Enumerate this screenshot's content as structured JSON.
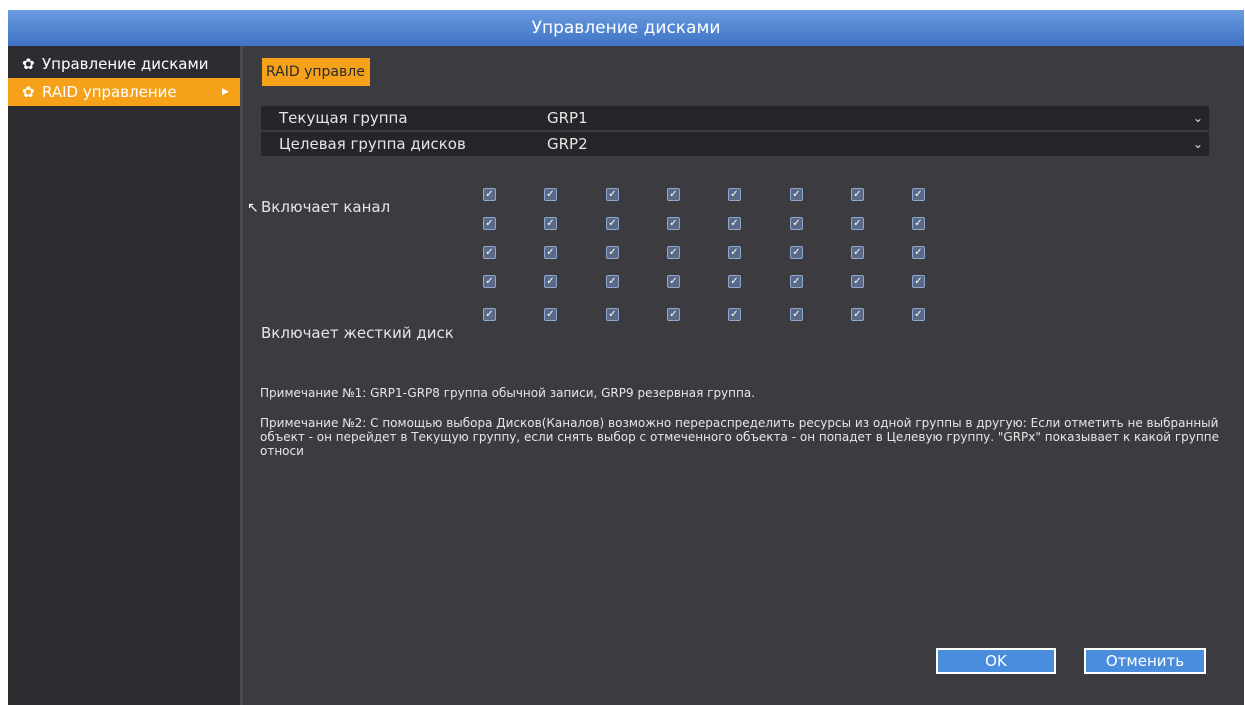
{
  "window": {
    "title": "Управление дисками"
  },
  "sidebar": {
    "items": [
      {
        "label": "Управление дисками",
        "icon": "gear-icon",
        "active": false
      },
      {
        "label": "RAID управление",
        "icon": "gears-icon",
        "active": true
      }
    ]
  },
  "main": {
    "tab_label": "RAID управле",
    "current_group": {
      "label": "Текущая группа",
      "value": "GRP1"
    },
    "target_group": {
      "label": "Целевая группа дисков",
      "value": "GRP2"
    },
    "channels": {
      "label": "Включает канал",
      "rows": 4,
      "cols": 8,
      "checked": true
    },
    "hdd": {
      "label": "Включает жесткий диск",
      "rows": 1,
      "cols": 8,
      "checked": true
    },
    "note1": "Примечание №1: GRP1-GRP8 группа обычной записи, GRP9 резервная группа.",
    "note2": "Примечание №2: С помощью выбора Дисков(Каналов) возможно перераспределить ресурсы из одной группы в другую: Если отметить не выбранный объект - он перейдет в Текущую группу, если снять выбор с отмеченного объекта - он попадет в Целевую группу. \"GRPx\" показывает к какой группе относи",
    "ok_label": "OK",
    "cancel_label": "Отменить"
  }
}
